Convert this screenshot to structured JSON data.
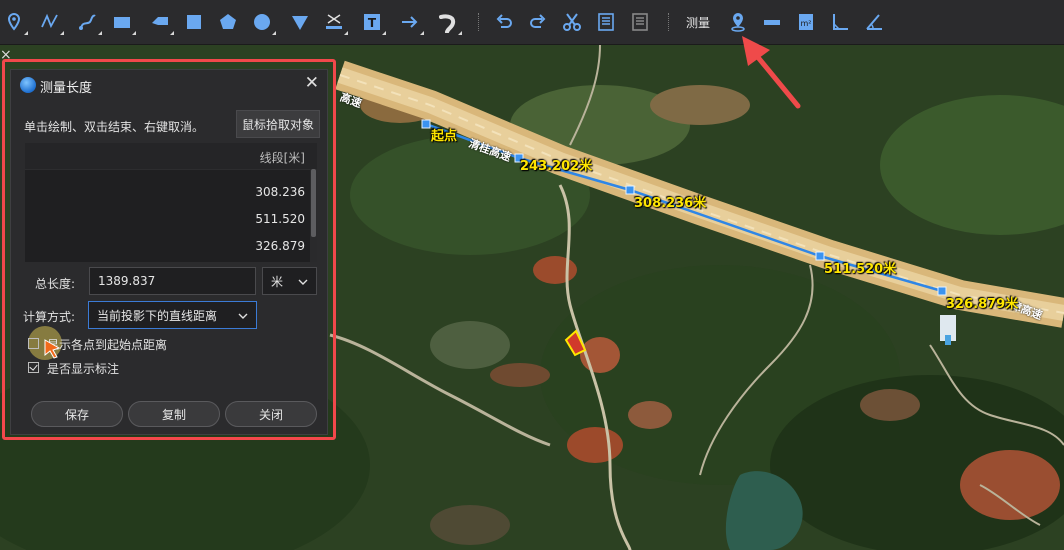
{
  "toolbar": {
    "measure_label": "测量",
    "icons": [
      "map-pin-icon",
      "polyline-icon",
      "curve-icon",
      "rectangle-icon",
      "arrow-shape-icon",
      "square-icon",
      "pentagon-icon",
      "circle-icon",
      "diamond-icon",
      "text-underline-icon",
      "text-box-icon",
      "arrow-right-icon",
      "hook-icon",
      "undo-icon",
      "redo-icon",
      "scissors-icon",
      "copy-frame-icon",
      "paste-frame-icon",
      "measure-point-icon",
      "measure-distance-icon",
      "measure-area-icon",
      "measure-height-icon",
      "measure-angle-icon"
    ]
  },
  "map": {
    "labels": {
      "start": "起点",
      "seg1": "243.202米",
      "seg2": "308.236米",
      "seg3": "511.520米",
      "seg4": "326.879米"
    },
    "road_names": {
      "a": "高速",
      "b": "清桂高速",
      "c": "漳高速"
    },
    "close_glyph": "×"
  },
  "dialog": {
    "title": "测量长度",
    "hint": "单击绘制、双击结束、右键取消。",
    "pick_button": "鼠标拾取对象",
    "table": {
      "header": "线段[米]",
      "rows": [
        "308.236",
        "511.520",
        "326.879"
      ]
    },
    "total_label": "总长度:",
    "total_value": "1389.837",
    "unit_value": "米",
    "method_label": "计算方式:",
    "method_value": "当前投影下的直线距离",
    "checkbox1": {
      "label": "显示各点到起始点距离",
      "checked": false
    },
    "checkbox2": {
      "label": "是否显示标注",
      "checked": true
    },
    "buttons": {
      "save": "保存",
      "copy": "复制",
      "close": "关闭"
    }
  },
  "colors": {
    "accent": "#3b7bd6",
    "highlight": "#f2484b",
    "label": "#ffe600"
  }
}
